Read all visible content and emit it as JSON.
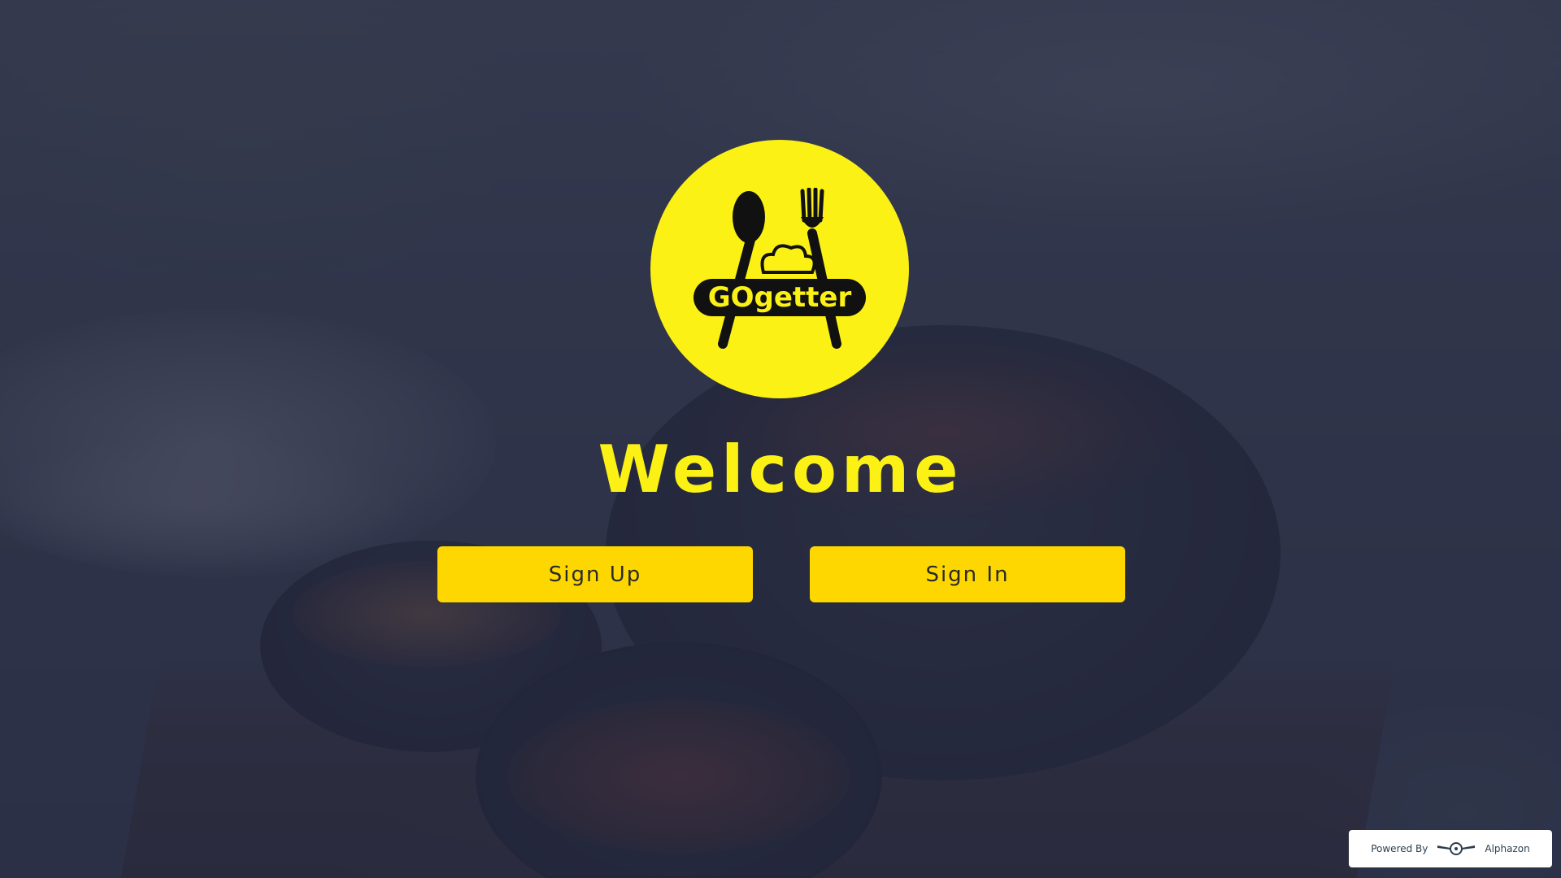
{
  "logo": {
    "brand_text": "GOgetter",
    "icon": "spoon-fork-chef-hat-icon",
    "circle_color": "#fcf114"
  },
  "main": {
    "welcome_text": "Welcome",
    "signup_label": "Sign Up",
    "signin_label": "Sign In"
  },
  "footer": {
    "powered_by_label": "Powered By",
    "powered_by_company": "Alphazon",
    "company_icon": "alphazon-wings-icon"
  },
  "colors": {
    "accent": "#fcf114",
    "button": "#ffd700",
    "overlay": "#262a42"
  }
}
